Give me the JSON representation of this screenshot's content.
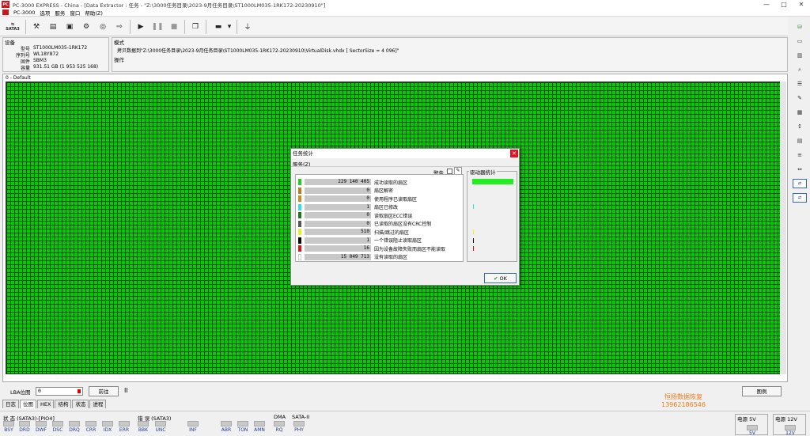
{
  "window": {
    "title": "PC-3000 EXPRESS - China - [Data Extractor : 任务 - \"Z:\\3000任务目录\\2023-9月任务目录\\ST1000LM035-1RK172-20230910\"]",
    "controls": [
      "—",
      "□",
      "✕"
    ]
  },
  "menu": {
    "items": [
      "PC-3000",
      "选项",
      "服务",
      "窗口",
      "帮助(Z)"
    ]
  },
  "toolbar": {
    "sata_label_top": "SATA3",
    "sata_label": "SATA3",
    "icons": [
      "power-cycle-icon",
      "tools-icon",
      "disk-icon",
      "clipboard-icon",
      "analyze-icon",
      "binoculars-icon",
      "export-icon",
      "play-icon",
      "pause-icon",
      "stop-icon",
      "copy-window-icon",
      "display-icon",
      "dropdown-icon",
      "reset-icon"
    ]
  },
  "device": {
    "header": "设备",
    "model_label": "型号",
    "model": "ST1000LM035-1RK172",
    "serial_label": "序列号",
    "serial": "WL18Y872",
    "firmware_label": "固件",
    "firmware": "SBM3",
    "capacity_label": "容量",
    "capacity": "931.51 GB (1 953 525 168)"
  },
  "mode": {
    "header": "模式",
    "path": "拷贝数据到\"Z:\\3000任务目录\\2023-9月任务目录\\ST1000LM035-1RK172-20230910\\VirtualDisk.vhdx [ SectorSize = 4 096]\"",
    "operation_header": "操作"
  },
  "map": {
    "label": "0 - Default"
  },
  "lba": {
    "label": "LBA位图",
    "value": "0",
    "go_label": "前往",
    "pause": "II",
    "legend_label": "图例"
  },
  "watermark": {
    "line1": "恒扬数据恢复",
    "line2": "13962186546"
  },
  "tabs": [
    "日志",
    "位图",
    "HEX",
    "结构",
    "状态",
    "进程"
  ],
  "status_bar": {
    "state_label": "状 态 (SATA3)-[PIO4]",
    "state_flags": [
      "BSY",
      "DRD",
      "DWF",
      "DSC",
      "DRQ",
      "CRR",
      "IDX",
      "ERR"
    ],
    "error_label": "错 误 (SATA3)",
    "error_flags": [
      "BBK",
      "UNC",
      "INF",
      "ABR",
      "TON",
      "AMN"
    ],
    "dma_label": "DMA",
    "dma_flag": "RQ",
    "sata_label": "SATA-II",
    "sata_flag": "PHY",
    "power5_label": "电源 5V",
    "power5_value": "5V",
    "power12_label": "电源 12V",
    "power12_value": "12V"
  },
  "dialog": {
    "title": "任务统计",
    "close": "✕",
    "menu": "服务(Z)",
    "warn_label": "警告",
    "drive_stats_label": "驱动器统计",
    "ok_label": "OK",
    "rows": [
      {
        "color": "#22cc22",
        "value": "229 140 405",
        "label": "成功读取的扇区"
      },
      {
        "color": "#c07a1a",
        "value": "0",
        "label": "扇区解密"
      },
      {
        "color": "#d08a1a",
        "value": "0",
        "label": "使用程序已读取扇区"
      },
      {
        "color": "#33ddee",
        "value": "1",
        "label": "扇区已修改"
      },
      {
        "color": "#1a7a1a",
        "value": "0",
        "label": "读取扇区ECC错误"
      },
      {
        "color": "#555555",
        "value": "0",
        "label": "已读取的扇区没有CRC控制"
      },
      {
        "color": "#eeee22",
        "value": "510",
        "label": "扫描/跳过的扇区"
      },
      {
        "color": "#000000",
        "value": "1",
        "label": "一个错误阻止读取扇区"
      },
      {
        "color": "#dd1111",
        "value": "16",
        "label": "因为设备故障失败而扇区不能读取"
      },
      {
        "color": "#ffffff",
        "value": "15 049 713",
        "label": "没有读取的扇区"
      }
    ]
  },
  "colors": {
    "map_green": "#00cc00",
    "brand_red": "#d0141c",
    "status_blue": "#1e3c9a",
    "watermark_orange": "#f07a1a"
  }
}
